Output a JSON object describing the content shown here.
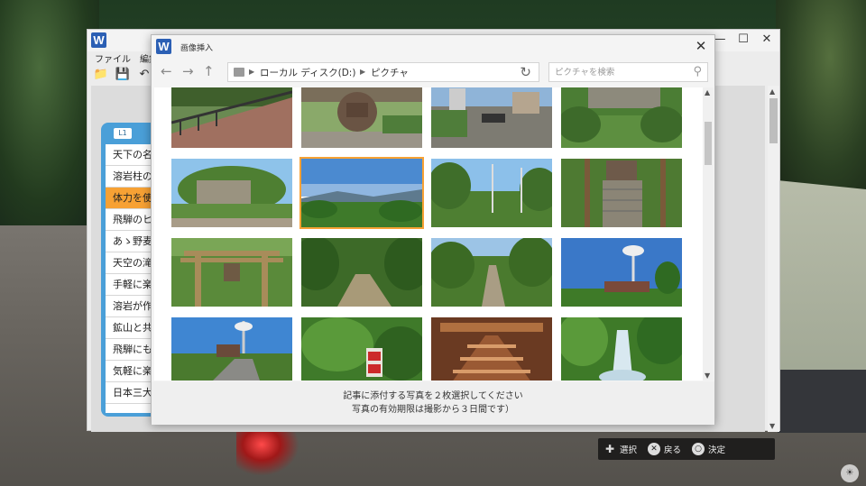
{
  "main_window": {
    "app_icon": "W",
    "menu": [
      "ファイル",
      "編集"
    ],
    "controls": {
      "minimize": "—",
      "maximize": "☐",
      "close": "✕"
    }
  },
  "list_panel": {
    "tag": "L1",
    "items": [
      "天下の名",
      "溶岩柱の",
      "体力を使",
      "飛騨のヒ",
      "あゝ野麦",
      "天空の滝",
      "手軽に楽",
      "溶岩が作",
      "鉱山と共",
      "飛騨にも",
      "気軽に楽",
      "日本三大"
    ],
    "active_index": 2
  },
  "dialog": {
    "icon": "W",
    "title": "画像挿入",
    "close": "✕",
    "address": {
      "crumbs": [
        "ローカル ディスク(D:)",
        "ピクチャ"
      ]
    },
    "search": {
      "placeholder": "ピクチャを検索"
    },
    "thumbnails": [
      {
        "scene": "bridge-railing"
      },
      {
        "scene": "stone-monument"
      },
      {
        "scene": "street-town"
      },
      {
        "scene": "rock-cliff-forest"
      },
      {
        "scene": "rock-cliff-green"
      },
      {
        "scene": "mountain-view",
        "selected": true
      },
      {
        "scene": "utility-poles-road"
      },
      {
        "scene": "stone-stairs-shrine"
      },
      {
        "scene": "torii-gate"
      },
      {
        "scene": "forest-trail"
      },
      {
        "scene": "forest-path"
      },
      {
        "scene": "radar-tower-blue"
      },
      {
        "scene": "radar-tower-road"
      },
      {
        "scene": "bushes-red-sign"
      },
      {
        "scene": "mine-interior"
      },
      {
        "scene": "waterfall"
      }
    ],
    "footer": {
      "line1": "記事に添付する写真を２枚選択してください",
      "line2": "写真の有効期限は撮影から３日間です）"
    }
  },
  "hints": [
    {
      "icon": "dpad-icon",
      "label": "選択"
    },
    {
      "icon": "cross-button-icon",
      "glyph": "✕",
      "label": "戻る"
    },
    {
      "icon": "circle-button-icon",
      "glyph": "○",
      "label": "決定"
    }
  ],
  "colors": {
    "accent_orange": "#f7a134",
    "panel_blue": "#4a9fd8",
    "app_blue": "#2b5fb4"
  }
}
